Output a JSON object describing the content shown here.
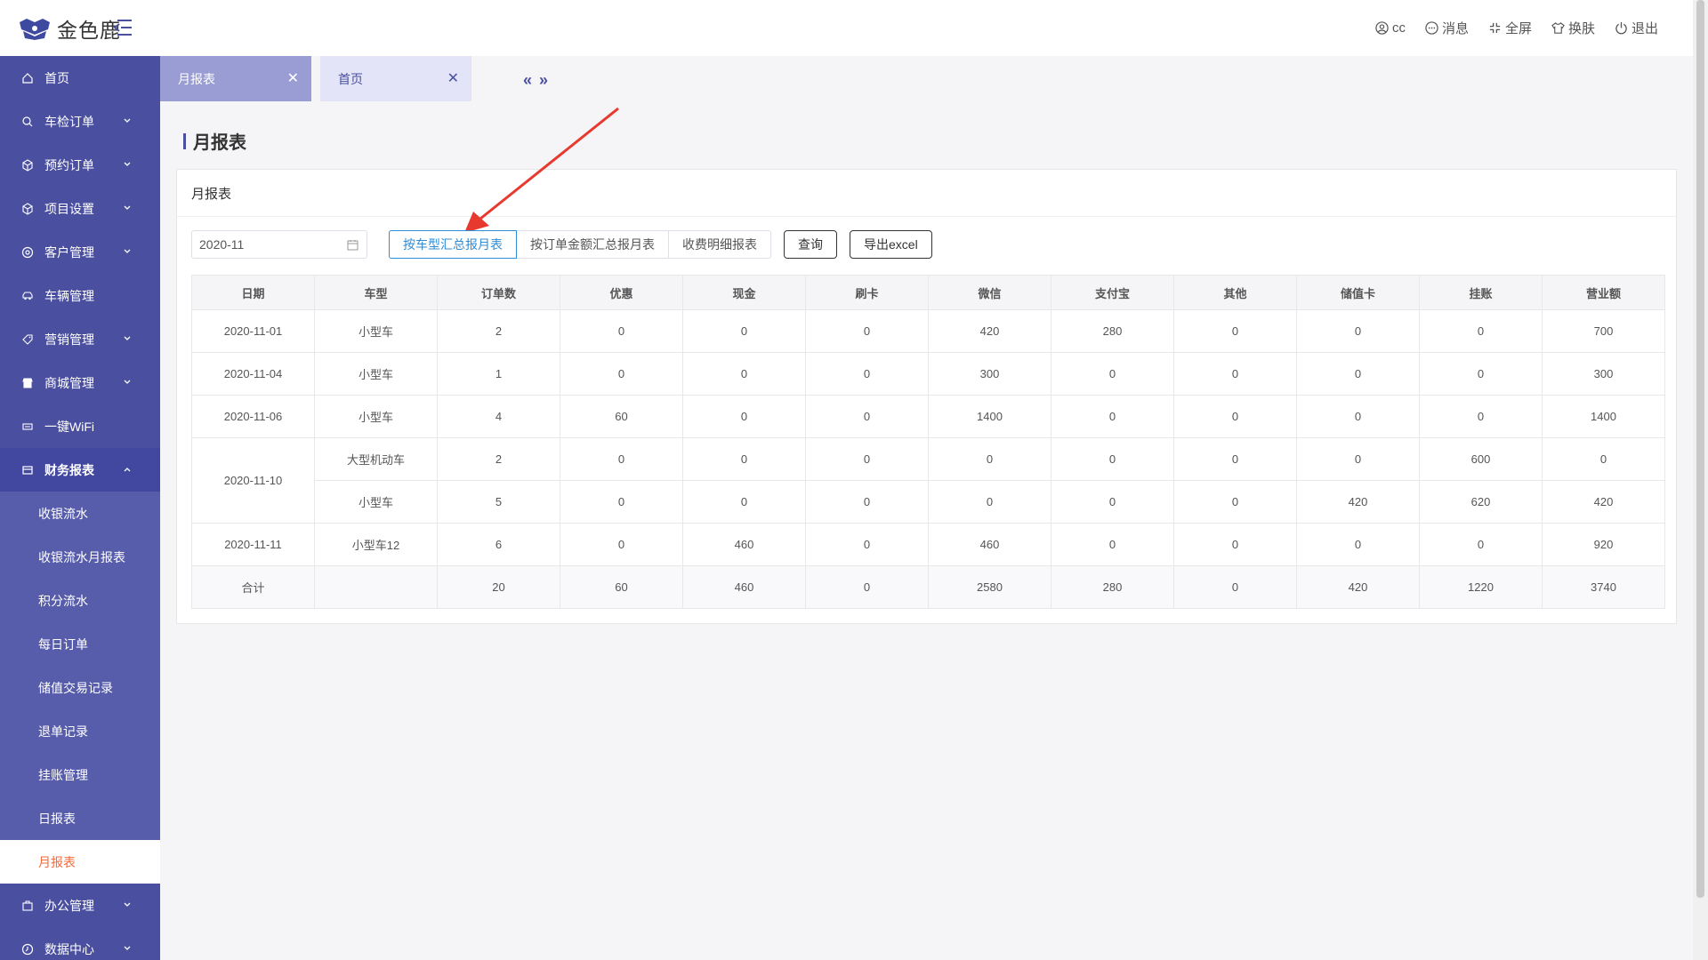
{
  "header": {
    "logo_text": "金色鹿",
    "user": "cc",
    "messages": "消息",
    "fullscreen": "全屏",
    "skin": "换肤",
    "logout": "退出"
  },
  "sidebar": {
    "items": [
      {
        "label": "首页"
      },
      {
        "label": "车检订单"
      },
      {
        "label": "预约订单"
      },
      {
        "label": "项目设置"
      },
      {
        "label": "客户管理"
      },
      {
        "label": "车辆管理"
      },
      {
        "label": "营销管理"
      },
      {
        "label": "商城管理"
      },
      {
        "label": "一键WiFi"
      },
      {
        "label": "财务报表"
      }
    ],
    "sub_items": [
      {
        "label": "收银流水"
      },
      {
        "label": "收银流水月报表"
      },
      {
        "label": "积分流水"
      },
      {
        "label": "每日订单"
      },
      {
        "label": "储值交易记录"
      },
      {
        "label": "退单记录"
      },
      {
        "label": "挂账管理"
      },
      {
        "label": "日报表"
      },
      {
        "label": "月报表"
      }
    ],
    "after_items": [
      {
        "label": "办公管理"
      },
      {
        "label": "数据中心"
      }
    ]
  },
  "tabs": [
    {
      "label": "月报表"
    },
    {
      "label": "首页"
    }
  ],
  "tab_arrows": {
    "prev": "«",
    "next": "»"
  },
  "page_title": "月报表",
  "card": {
    "title": "月报表",
    "date_value": "2020-11",
    "buttons": {
      "by_car_type": "按车型汇总报月表",
      "by_order_amount": "按订单金额汇总报月表",
      "fee_detail": "收费明细报表",
      "query": "查询",
      "export": "导出excel"
    }
  },
  "table": {
    "columns": [
      "日期",
      "车型",
      "订单数",
      "优惠",
      "现金",
      "刷卡",
      "微信",
      "支付宝",
      "其他",
      "储值卡",
      "挂账",
      "营业额"
    ],
    "rows": [
      {
        "date": "2020-11-01",
        "rowspan": 1,
        "car": "小型车",
        "vals": [
          "2",
          "0",
          "0",
          "0",
          "420",
          "280",
          "0",
          "0",
          "0",
          "700"
        ]
      },
      {
        "date": "2020-11-04",
        "rowspan": 1,
        "car": "小型车",
        "vals": [
          "1",
          "0",
          "0",
          "0",
          "300",
          "0",
          "0",
          "0",
          "0",
          "300"
        ]
      },
      {
        "date": "2020-11-06",
        "rowspan": 1,
        "car": "小型车",
        "vals": [
          "4",
          "60",
          "0",
          "0",
          "1400",
          "0",
          "0",
          "0",
          "0",
          "1400"
        ]
      },
      {
        "date": "2020-11-10",
        "rowspan": 2,
        "car": "大型机动车",
        "vals": [
          "2",
          "0",
          "0",
          "0",
          "0",
          "0",
          "0",
          "0",
          "600",
          "0"
        ]
      },
      {
        "date": null,
        "rowspan": 0,
        "car": "小型车",
        "vals": [
          "5",
          "0",
          "0",
          "0",
          "0",
          "0",
          "0",
          "420",
          "620",
          "420"
        ]
      },
      {
        "date": "2020-11-11",
        "rowspan": 1,
        "car": "小型车12",
        "vals": [
          "6",
          "0",
          "460",
          "0",
          "460",
          "0",
          "0",
          "0",
          "0",
          "920"
        ]
      }
    ],
    "total": {
      "label": "合计",
      "car": "",
      "vals": [
        "20",
        "60",
        "460",
        "0",
        "2580",
        "280",
        "0",
        "420",
        "1220",
        "3740"
      ]
    }
  },
  "colors": {
    "sidebar_bg": "#4a4fa0",
    "active_sub": "#f5683a",
    "active_button": "#2f8cd5",
    "annotation_arrow": "#e8392f"
  }
}
